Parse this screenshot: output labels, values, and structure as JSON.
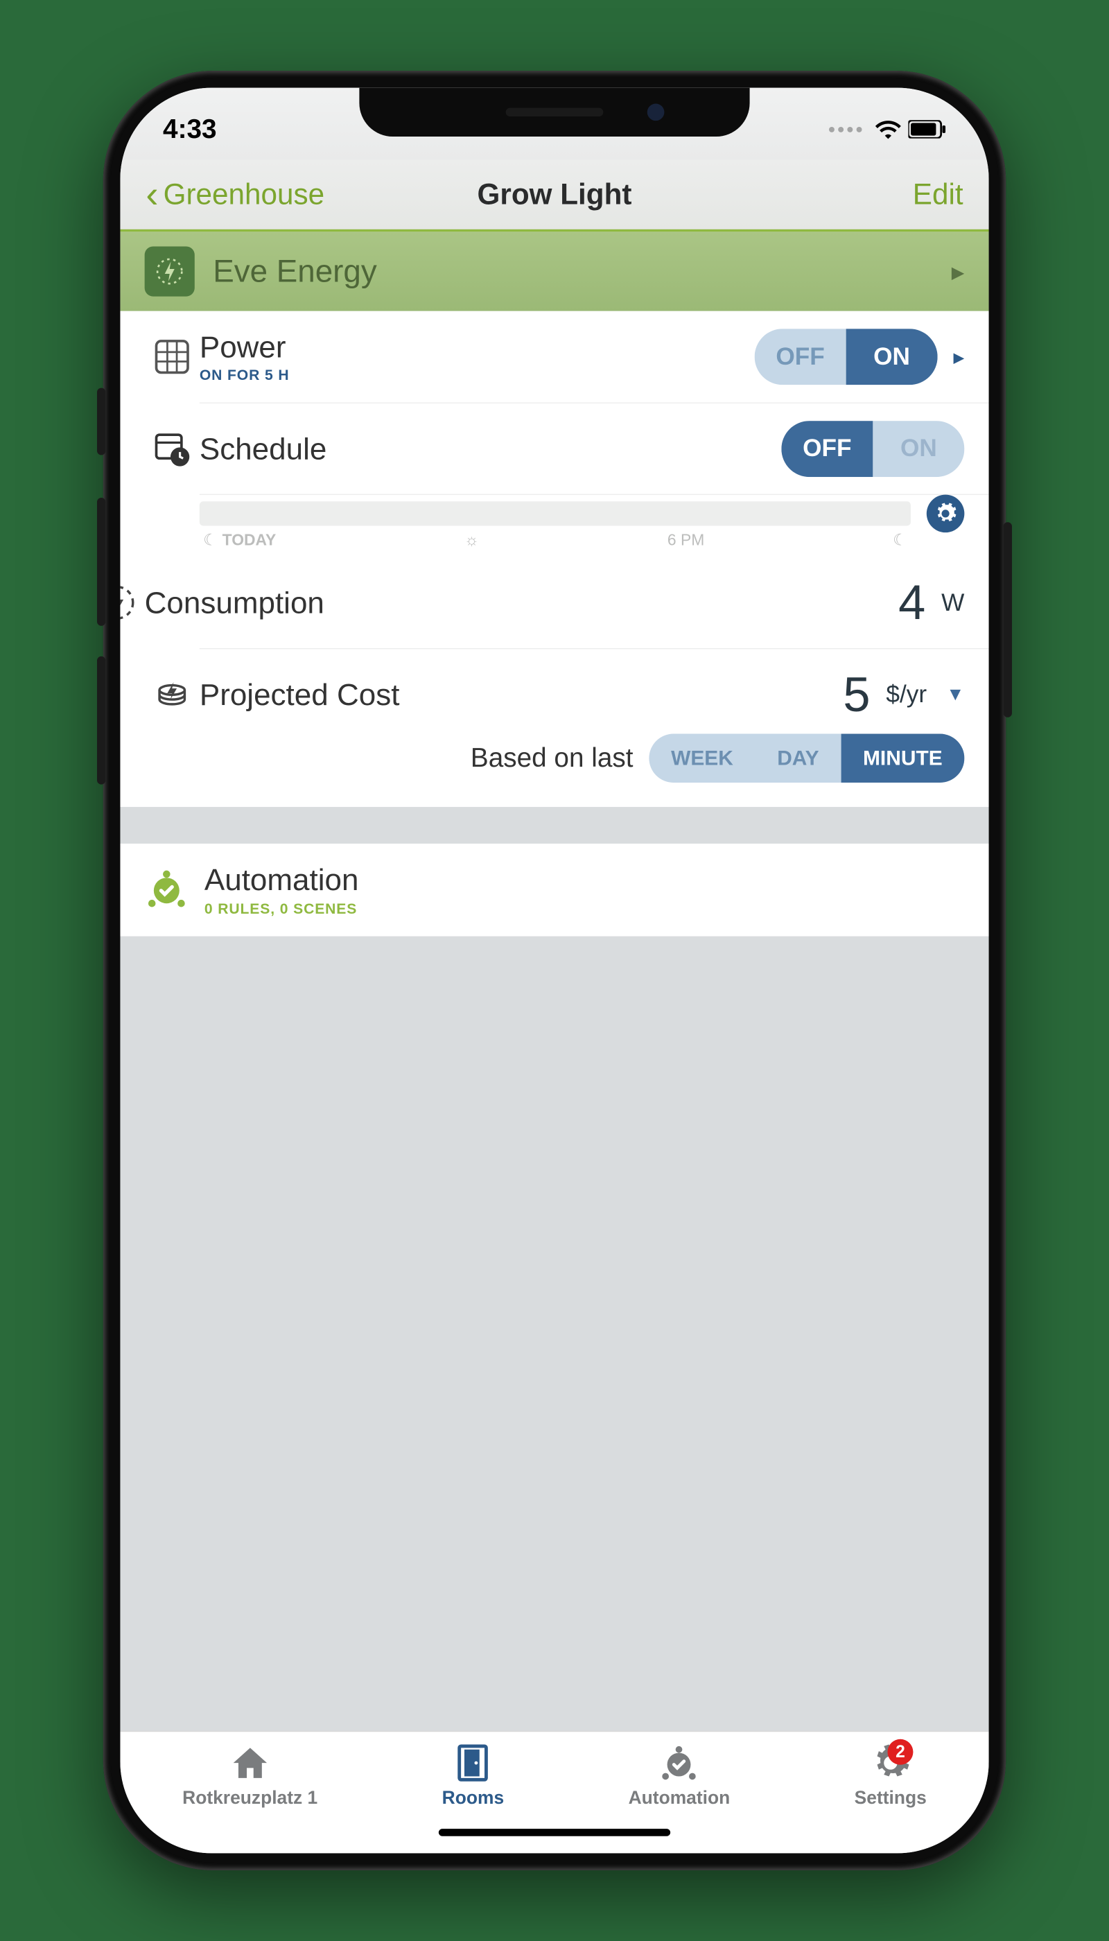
{
  "status": {
    "time": "4:33"
  },
  "nav": {
    "back": "Greenhouse",
    "title": "Grow Light",
    "edit": "Edit"
  },
  "device": {
    "name": "Eve Energy"
  },
  "power": {
    "title": "Power",
    "sub": "ON FOR 5 H",
    "off": "OFF",
    "on": "ON",
    "state": "on"
  },
  "schedule": {
    "title": "Schedule",
    "off": "OFF",
    "on": "ON",
    "state": "off",
    "ticks": {
      "today": "TODAY",
      "sun": "☼",
      "pm": "6 PM"
    }
  },
  "consumption": {
    "title": "Consumption",
    "value": "4",
    "unit": "W"
  },
  "cost": {
    "title": "Projected Cost",
    "value": "5",
    "unit": "$/yr",
    "basedon_label": "Based on last",
    "opts": {
      "week": "WEEK",
      "day": "DAY",
      "minute": "MINUTE"
    },
    "selected": "minute"
  },
  "automation": {
    "title": "Automation",
    "sub": "0 RULES, 0 SCENES"
  },
  "tabs": {
    "home": "Rotkreuzplatz 1",
    "rooms": "Rooms",
    "automation": "Automation",
    "settings": "Settings",
    "settings_badge": "2"
  }
}
